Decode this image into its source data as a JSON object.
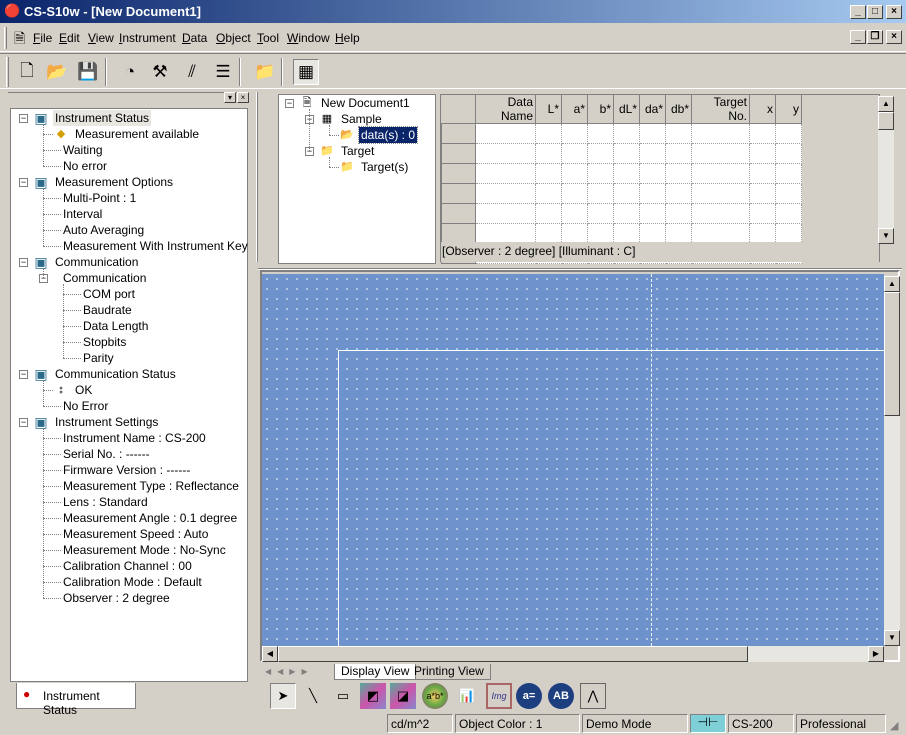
{
  "window": {
    "title": "CS-S10w - [New Document1]"
  },
  "menu": [
    "File",
    "Edit",
    "View",
    "Instrument",
    "Data",
    "Object",
    "Tool",
    "Window",
    "Help"
  ],
  "toolbar": [
    {
      "icon": "new-document-icon",
      "glyph": "🗋"
    },
    {
      "icon": "open-folder-icon",
      "glyph": "📂"
    },
    {
      "icon": "save-icon",
      "glyph": "💾"
    },
    {
      "icon": "measure-icon",
      "glyph": "◔"
    },
    {
      "icon": "instrument-settings-icon",
      "glyph": "⚒"
    },
    {
      "icon": "target-icon",
      "glyph": "⫽"
    },
    {
      "icon": "layers-icon",
      "glyph": "☰"
    },
    {
      "icon": "folder-icon",
      "glyph": "📁"
    },
    {
      "icon": "list-view-icon",
      "glyph": "▦"
    }
  ],
  "left_tree": [
    {
      "level": 0,
      "label": "Instrument Status",
      "icon": "instrument-status-icon",
      "expanded": true,
      "selected": true
    },
    {
      "level": 1,
      "label": "Measurement available",
      "icon": "warning-icon"
    },
    {
      "level": 1,
      "label": "Waiting"
    },
    {
      "level": 1,
      "label": "No error"
    },
    {
      "level": 0,
      "label": "Measurement Options",
      "icon": "measurement-options-icon",
      "expanded": true
    },
    {
      "level": 1,
      "label": "Multi-Point : 1"
    },
    {
      "level": 1,
      "label": "Interval"
    },
    {
      "level": 1,
      "label": "Auto Averaging"
    },
    {
      "level": 1,
      "label": "Measurement With Instrument Key"
    },
    {
      "level": 0,
      "label": "Communication",
      "icon": "communication-icon",
      "expanded": true
    },
    {
      "level": 1,
      "label": "Communication",
      "expanded": true
    },
    {
      "level": 2,
      "label": "COM port"
    },
    {
      "level": 2,
      "label": "Baudrate"
    },
    {
      "level": 2,
      "label": "Data Length"
    },
    {
      "level": 2,
      "label": "Stopbits"
    },
    {
      "level": 2,
      "label": "Parity"
    },
    {
      "level": 0,
      "label": "Communication Status",
      "icon": "communication-status-icon",
      "expanded": true
    },
    {
      "level": 1,
      "label": "OK",
      "icon": "traffic-light-icon"
    },
    {
      "level": 1,
      "label": "No Error"
    },
    {
      "level": 0,
      "label": "Instrument Settings",
      "icon": "instrument-settings-icon",
      "expanded": true
    },
    {
      "level": 1,
      "label": "Instrument Name : CS-200"
    },
    {
      "level": 1,
      "label": "Serial No. : ------"
    },
    {
      "level": 1,
      "label": "Firmware Version : ------"
    },
    {
      "level": 1,
      "label": "Measurement Type : Reflectance"
    },
    {
      "level": 1,
      "label": "Lens : Standard"
    },
    {
      "level": 1,
      "label": "Measurement Angle : 0.1 degree"
    },
    {
      "level": 1,
      "label": "Measurement Speed : Auto"
    },
    {
      "level": 1,
      "label": "Measurement Mode : No-Sync"
    },
    {
      "level": 1,
      "label": "Calibration Channel : 00"
    },
    {
      "level": 1,
      "label": "Calibration Mode : Default"
    },
    {
      "level": 1,
      "label": "Observer : 2 degree"
    }
  ],
  "left_tab": "Instrument Status",
  "doc_tree": [
    {
      "level": 0,
      "label": "New Document1",
      "icon": "document-icon",
      "expanded": true
    },
    {
      "level": 1,
      "label": "Sample",
      "icon": "sample-icon",
      "expanded": true
    },
    {
      "level": 2,
      "label": "data(s) : 0",
      "icon": "data-folder-icon",
      "selected": true
    },
    {
      "level": 1,
      "label": "Target",
      "icon": "folder-icon",
      "expanded": true
    },
    {
      "level": 2,
      "label": "Target(s)",
      "icon": "folder-icon"
    }
  ],
  "grid": {
    "columns": [
      "Data Name",
      "L*",
      "a*",
      "b*",
      "dL*",
      "da*",
      "db*",
      "Target No.",
      "x",
      "y"
    ],
    "rows": 7,
    "footer": "[Observer : 2 degree]  [Illuminant : C]"
  },
  "view_tabs": [
    "Display View",
    "Printing View"
  ],
  "active_view_tab": "Display View",
  "draw_tools": [
    {
      "icon": "pointer-icon",
      "glyph": "➤",
      "active": true
    },
    {
      "icon": "line-tool-icon",
      "glyph": "╲"
    },
    {
      "icon": "rounded-rect-tool-icon",
      "glyph": "▭"
    },
    {
      "icon": "xy-chromaticity-icon",
      "glyph": "◩"
    },
    {
      "icon": "uv-chromaticity-icon",
      "glyph": "◪"
    },
    {
      "icon": "ab-color-wheel-icon",
      "glyph": "a*b*"
    },
    {
      "icon": "spectral-graph-icon",
      "glyph": "📊"
    },
    {
      "icon": "image-icon",
      "glyph": "Img"
    },
    {
      "icon": "color-value-icon",
      "glyph": "a="
    },
    {
      "icon": "ab-label-icon",
      "glyph": "AB"
    },
    {
      "icon": "trend-graph-icon",
      "glyph": "⋀"
    }
  ],
  "status": {
    "unit": "cd/m^2",
    "object_color": "Object Color : 1",
    "mode": "Demo Mode",
    "connection_icon": "connector-icon",
    "instrument": "CS-200",
    "edition": "Professional"
  },
  "colors": {
    "title_start": "#0a246a",
    "title_end": "#a6caf0",
    "canvas": "#6e93cc",
    "selection": "#0a246a"
  }
}
